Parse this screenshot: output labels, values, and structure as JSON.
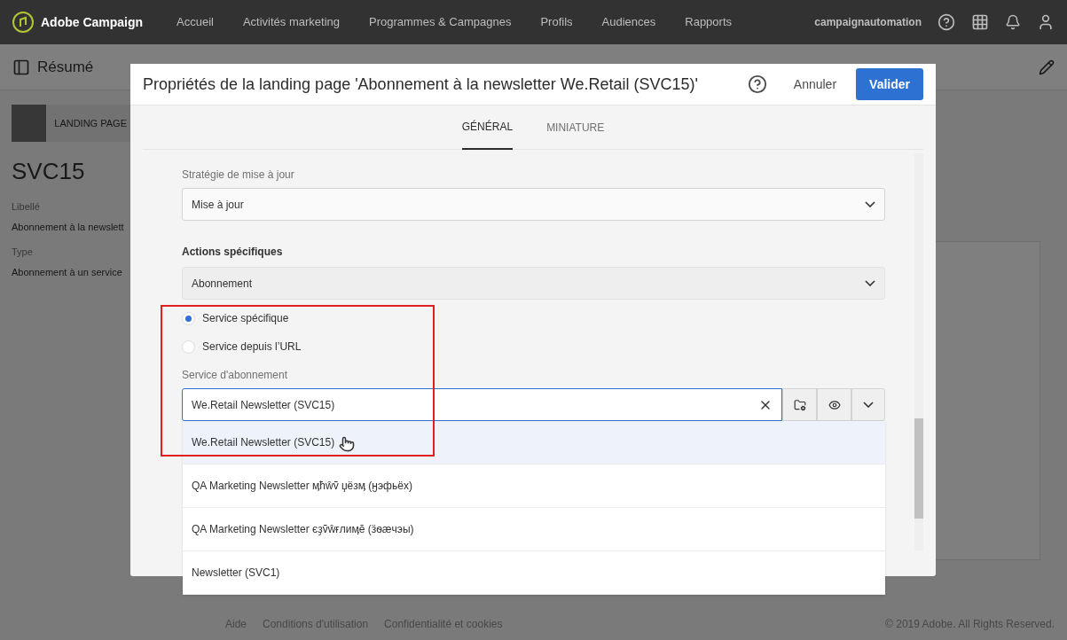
{
  "app_bar": {
    "brand": "Adobe Campaign",
    "nav": [
      {
        "label": "Accueil",
        "selected": false
      },
      {
        "label": "Activités marketing",
        "selected": false
      },
      {
        "label": "Programmes & Campagnes",
        "selected": false
      },
      {
        "label": "Profils",
        "selected": false
      },
      {
        "label": "Audiences",
        "selected": false
      },
      {
        "label": "Rapports",
        "selected": false
      }
    ],
    "user": "campaignautomation"
  },
  "page": {
    "title": "Résumé",
    "card_label": "LANDING PAGE",
    "name": "SVC15",
    "fields": [
      {
        "label": "Libellé",
        "value": "Abonnement à la newslett"
      },
      {
        "label": "Type",
        "value": "Abonnement à un service"
      }
    ]
  },
  "footer": {
    "links": [
      "Aide",
      "Conditions d'utilisation",
      "Confidentialité et cookies"
    ],
    "copyright": "© 2019 Adobe. All Rights Reserved."
  },
  "dialog": {
    "title": "Propriétés de la landing page 'Abonnement à la newsletter We.Retail (SVC15)'",
    "cancel": "Annuler",
    "confirm": "Valider",
    "tabs": [
      {
        "label": "GÉNÉRAL",
        "selected": true
      },
      {
        "label": "MINIATURE",
        "selected": false
      }
    ],
    "strategy": {
      "label": "Stratégie de mise à jour",
      "value": "Mise à jour"
    },
    "actions": {
      "label": "Actions spécifiques",
      "value": "Abonnement"
    },
    "radios": [
      {
        "label": "Service spécifique",
        "selected": true
      },
      {
        "label": "Service depuis l’URL",
        "selected": false
      }
    ],
    "service": {
      "label": "Service d'abonnement",
      "value": "We.Retail Newsletter (SVC15)"
    },
    "suggestions": [
      {
        "label": "We.Retail Newsletter (SVC15)",
        "selected": true
      },
      {
        "label": "QA Marketing Newsletter ӎћŵṽ џёзӎ (ӈэфьёх)",
        "selected": false
      },
      {
        "label": "QA Marketing Newsletter єҙṽŵғлᴎӎĕ (ӟѳӕчэы)",
        "selected": false
      },
      {
        "label": "Newsletter (SVC1)",
        "selected": false
      }
    ]
  }
}
